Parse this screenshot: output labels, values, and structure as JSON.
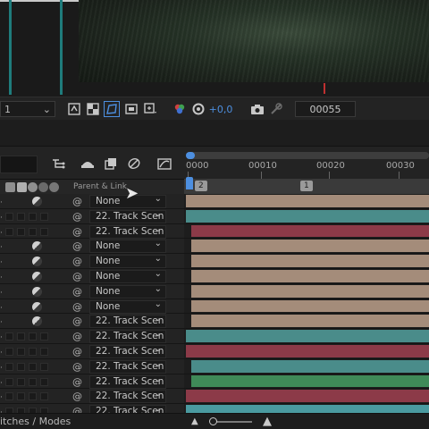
{
  "viewer": {
    "resolution_value": "1",
    "timecode": "00055",
    "exposure_value": "+0,0",
    "accent_blue": "#4d8fe0"
  },
  "toolbar_icons": [
    "fast-preview-icon",
    "transparency-grid-icon",
    "mask-path-icon",
    "region-of-interest-icon",
    "guides-icon",
    "channel-icon",
    "reset-exposure-icon",
    "snapshot-icon",
    "show-snapshot-icon"
  ],
  "timeline": {
    "ruler_ticks": [
      "0000",
      "00010",
      "00020",
      "00030"
    ],
    "column_header": "Parent & Link",
    "markers": [
      "2",
      "1"
    ],
    "status_label": "itches / Modes"
  },
  "layers": [
    {
      "solo": true,
      "parent": "None",
      "color": "#a48c7a"
    },
    {
      "solo": false,
      "parent": "22. Track Scen",
      "color": "#4a8c8a"
    },
    {
      "solo": false,
      "parent": "22. Track Scen",
      "color": "#8c3a48"
    },
    {
      "solo": true,
      "parent": "None",
      "color": "#a48c7a"
    },
    {
      "solo": true,
      "parent": "None",
      "color": "#a48c7a"
    },
    {
      "solo": true,
      "parent": "None",
      "color": "#a48c7a"
    },
    {
      "solo": true,
      "parent": "None",
      "color": "#a48c7a"
    },
    {
      "solo": true,
      "parent": "None",
      "color": "#a48c7a"
    },
    {
      "solo": true,
      "parent": "22. Track Scen",
      "color": "#a48c7a"
    },
    {
      "solo": false,
      "parent": "22. Track Scen",
      "color": "#4a8c8a"
    },
    {
      "solo": false,
      "parent": "22. Track Scen",
      "color": "#8c3a48"
    },
    {
      "solo": false,
      "parent": "22. Track Scen",
      "color": "#4a8c8a"
    },
    {
      "solo": false,
      "parent": "22. Track Scen",
      "color": "#3f8a58"
    },
    {
      "solo": false,
      "parent": "22. Track Scen",
      "color": "#8c3a48"
    },
    {
      "solo": false,
      "parent": "22. Track Scen",
      "color": "#4a9aa0"
    }
  ]
}
